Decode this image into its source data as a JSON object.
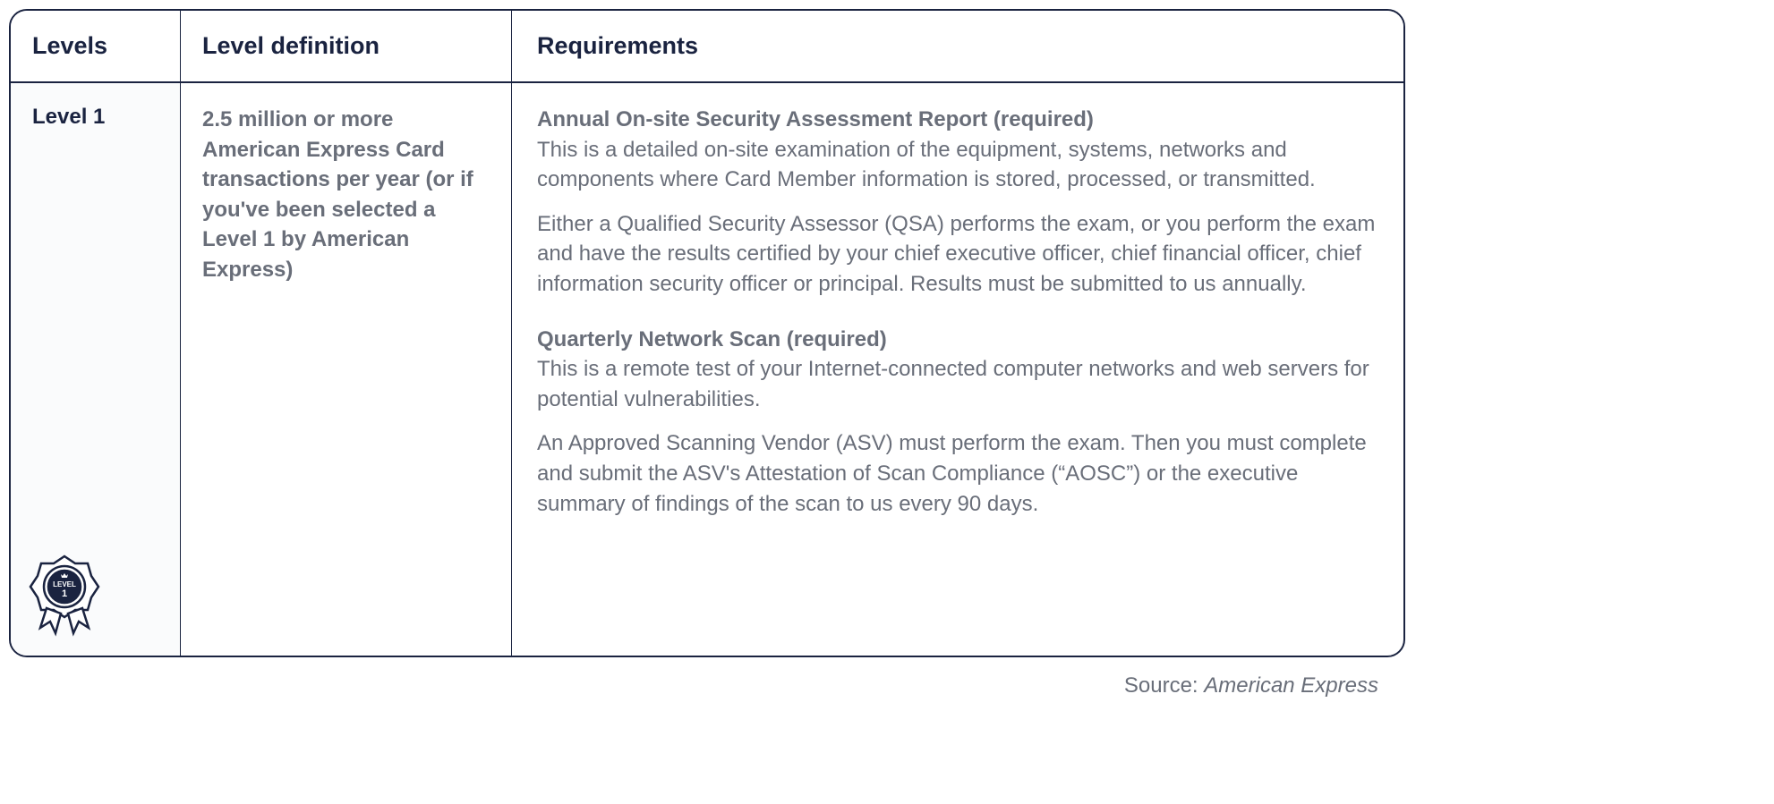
{
  "headers": {
    "levels": "Levels",
    "definition": "Level definition",
    "requirements": "Requirements"
  },
  "row": {
    "level": "Level 1",
    "definition": "2.5 million or more American Express Card transactions per year (or if you've been selected a Level 1 by American Express)",
    "badge_text": "LEVEL",
    "badge_number": "1",
    "requirements": [
      {
        "title": "Annual On-site Security Assessment Report (required)",
        "desc1": "This is a detailed on-site examination of the equipment, systems, networks and components where Card Member information is stored, processed, or transmitted.",
        "desc2": "Either a Qualified Security Assessor (QSA) performs the exam, or you perform the exam and have the results certified by your chief executive officer, chief financial officer, chief information security officer or principal. Results must be submitted to us annually."
      },
      {
        "title": "Quarterly Network Scan (required)",
        "desc1": "This is a remote test of your Internet-connected computer networks and web servers for potential vulnerabilities.",
        "desc2": "An Approved Scanning Vendor (ASV) must perform the exam. Then you must complete and submit the ASV's Attestation of Scan Compliance (“AOSC”) or the executive summary of findings of the scan to us every 90 days."
      }
    ]
  },
  "source": {
    "label": "Source: ",
    "value": "American Express"
  }
}
